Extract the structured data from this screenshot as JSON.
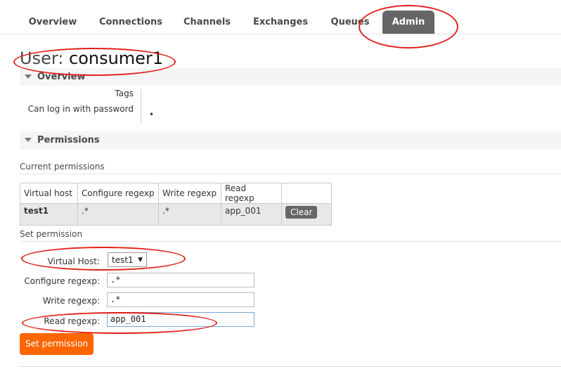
{
  "nav": {
    "tabs": [
      {
        "label": "Overview"
      },
      {
        "label": "Connections"
      },
      {
        "label": "Channels"
      },
      {
        "label": "Exchanges"
      },
      {
        "label": "Queues"
      },
      {
        "label": "Admin",
        "active": true
      }
    ]
  },
  "page": {
    "title_prefix": "User: ",
    "user_name": "consumer1"
  },
  "overview": {
    "heading": "Overview",
    "tags_label": "Tags",
    "tags_value": "",
    "login_label": "Can log in with password",
    "login_value": "•"
  },
  "permissions": {
    "heading": "Permissions",
    "current_label": "Current permissions",
    "columns": [
      "Virtual host",
      "Configure regexp",
      "Write regexp",
      "Read regexp",
      ""
    ],
    "rows": [
      {
        "vhost": "test1",
        "configure": ".*",
        "write": ".*",
        "read": "app_001",
        "action": "Clear"
      }
    ],
    "set_label": "Set permission",
    "form": {
      "vhost_label": "Virtual Host:",
      "vhost_value": "test1",
      "configure_label": "Configure regexp:",
      "configure_value": ".*",
      "write_label": "Write regexp:",
      "write_value": ".*",
      "read_label": "Read regexp:",
      "read_value": "app_001",
      "submit_label": "Set permission"
    }
  },
  "colors": {
    "accent": "#ff6600",
    "active_tab": "#666666",
    "annotation": "#e0211b"
  }
}
